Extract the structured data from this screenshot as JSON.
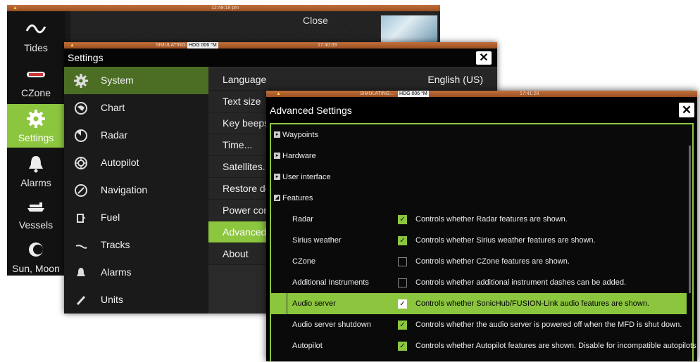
{
  "home": {
    "time": "12:49:18 pm",
    "close_label": "Close",
    "items": [
      {
        "label": "Tides",
        "icon": "tides-wave-icon"
      },
      {
        "label": "CZone",
        "icon": "czone-logo"
      },
      {
        "label": "Settings",
        "icon": "gear-icon"
      },
      {
        "label": "Alarms",
        "icon": "bell-icon"
      },
      {
        "label": "Vessels",
        "icon": "vessels-icon"
      },
      {
        "label": "Sun, Moon",
        "icon": "sun-moon-icon"
      }
    ]
  },
  "settings": {
    "status_sim": "SIMULATING...",
    "status_hdg": "HDG 006 °M",
    "time": "17:40:09",
    "title": "Settings",
    "menu": [
      {
        "label": "System",
        "icon": "gear-icon"
      },
      {
        "label": "Chart",
        "icon": "chart-icon"
      },
      {
        "label": "Radar",
        "icon": "radar-icon"
      },
      {
        "label": "Autopilot",
        "icon": "autopilot-icon"
      },
      {
        "label": "Navigation",
        "icon": "compass-icon"
      },
      {
        "label": "Fuel",
        "icon": "fuel-pump-icon"
      },
      {
        "label": "Tracks",
        "icon": "tracks-icon"
      },
      {
        "label": "Alarms",
        "icon": "bell-icon"
      },
      {
        "label": "Units",
        "icon": "ruler-icon"
      }
    ],
    "items": [
      {
        "label": "Language",
        "value": "English (US)"
      },
      {
        "label": "Text size",
        "value": ""
      },
      {
        "label": "Key beeps",
        "value": ""
      },
      {
        "label": "Time...",
        "value": ""
      },
      {
        "label": "Satellites...",
        "value": ""
      },
      {
        "label": "Restore de",
        "value": ""
      },
      {
        "label": "Power con",
        "value": ""
      },
      {
        "label": "Advanced...",
        "value": ""
      },
      {
        "label": "About",
        "value": ""
      }
    ]
  },
  "advanced": {
    "status_sim": "SIMULATING...",
    "status_hdg": "HDG 006 °M",
    "time": "17:41:28",
    "title": "Advanced Settings",
    "tree": [
      {
        "label": "Waypoints",
        "expanded": false
      },
      {
        "label": "Hardware",
        "expanded": false
      },
      {
        "label": "User interface",
        "expanded": false
      },
      {
        "label": "Features",
        "expanded": true
      }
    ],
    "features": [
      {
        "name": "Radar",
        "checked": true,
        "desc": "Controls whether Radar features are shown."
      },
      {
        "name": "Sirius weather",
        "checked": true,
        "desc": "Controls whether Sirius weather features are shown."
      },
      {
        "name": "CZone",
        "checked": false,
        "desc": "Controls whether CZone features are shown."
      },
      {
        "name": "Additional Instruments",
        "checked": false,
        "desc": "Controls whether additional instrument dashes can be added."
      },
      {
        "name": "Audio server",
        "checked": true,
        "desc": "Controls whether SonicHub/FUSION-Link audio features are shown."
      },
      {
        "name": "Audio server shutdown",
        "checked": true,
        "desc": "Controls whether the audio server is powered off when the MFD is shut down."
      },
      {
        "name": "Autopilot",
        "checked": true,
        "desc": "Controls whether Autopilot features are shown. Disable for incompatible autopilots"
      }
    ],
    "accent": "#8cc63f"
  }
}
